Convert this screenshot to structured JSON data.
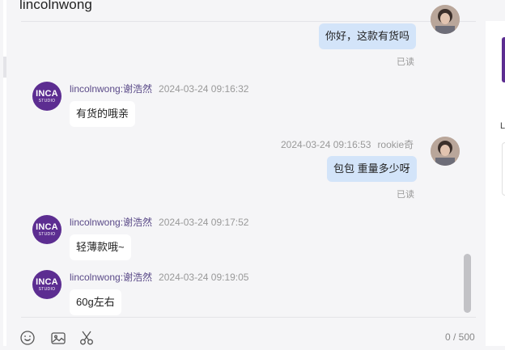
{
  "header": {
    "title": "lincolnwong"
  },
  "messages": [
    {
      "type": "out",
      "text": "你好，这款有货吗",
      "status": "已读"
    },
    {
      "type": "in",
      "sender": "lincolnwong:谢浩然",
      "time": "2024-03-24 09:16:32",
      "text": "有货的哦亲"
    },
    {
      "type": "out",
      "time": "2024-03-24 09:16:53",
      "sender": "rookie奇",
      "text": "包包 重量多少呀",
      "status": "已读"
    },
    {
      "type": "in",
      "sender": "lincolnwong:谢浩然",
      "time": "2024-03-24 09:17:52",
      "text": "轻薄款哦~"
    },
    {
      "type": "in",
      "sender": "lincolnwong:谢浩然",
      "time": "2024-03-24 09:19:05",
      "text": "60g左右"
    }
  ],
  "avatar_logo": {
    "line1": "INCA",
    "line2": "STUDIO"
  },
  "input": {
    "counter": "0 / 500"
  },
  "toolbar": {
    "icons": [
      "emoji-icon",
      "image-icon",
      "scissors-icon"
    ]
  },
  "side_panel": {
    "char": "L"
  },
  "colors": {
    "brand_purple": "#5c2d91",
    "outgoing_bubble": "#d3e4f9",
    "incoming_bubble": "#ffffff"
  }
}
